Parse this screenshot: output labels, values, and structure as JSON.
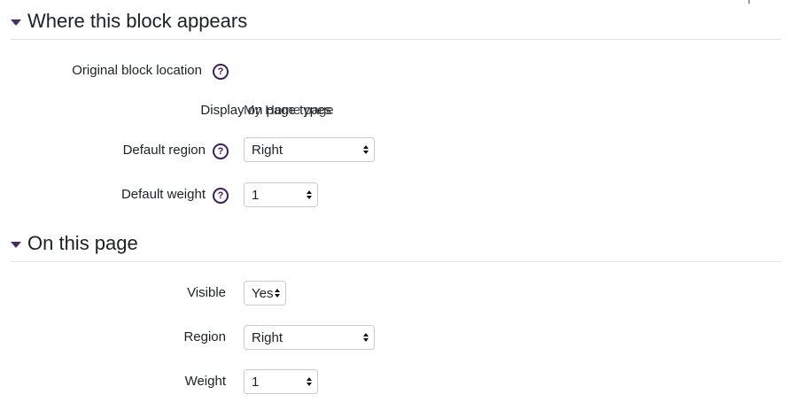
{
  "sections": {
    "where": {
      "title": "Where this block appears",
      "original_location_label": "Original block location",
      "page_types_label": "Display on page types",
      "page_types_value": "My Home page",
      "default_region_label": "Default region",
      "default_region_value": "Right",
      "default_weight_label": "Default weight",
      "default_weight_value": "1"
    },
    "on_page": {
      "title": "On this page",
      "visible_label": "Visible",
      "visible_value": "Yes",
      "region_label": "Region",
      "region_value": "Right",
      "weight_label": "Weight",
      "weight_value": "1"
    }
  },
  "icons": {
    "help": "question-circle-icon",
    "section_toggle": "caret-down-icon",
    "select_arrows": "up-down-arrows-icon"
  },
  "colors": {
    "accent": "#3e1e63",
    "text": "#1d2125",
    "border": "#c9cdd2"
  }
}
